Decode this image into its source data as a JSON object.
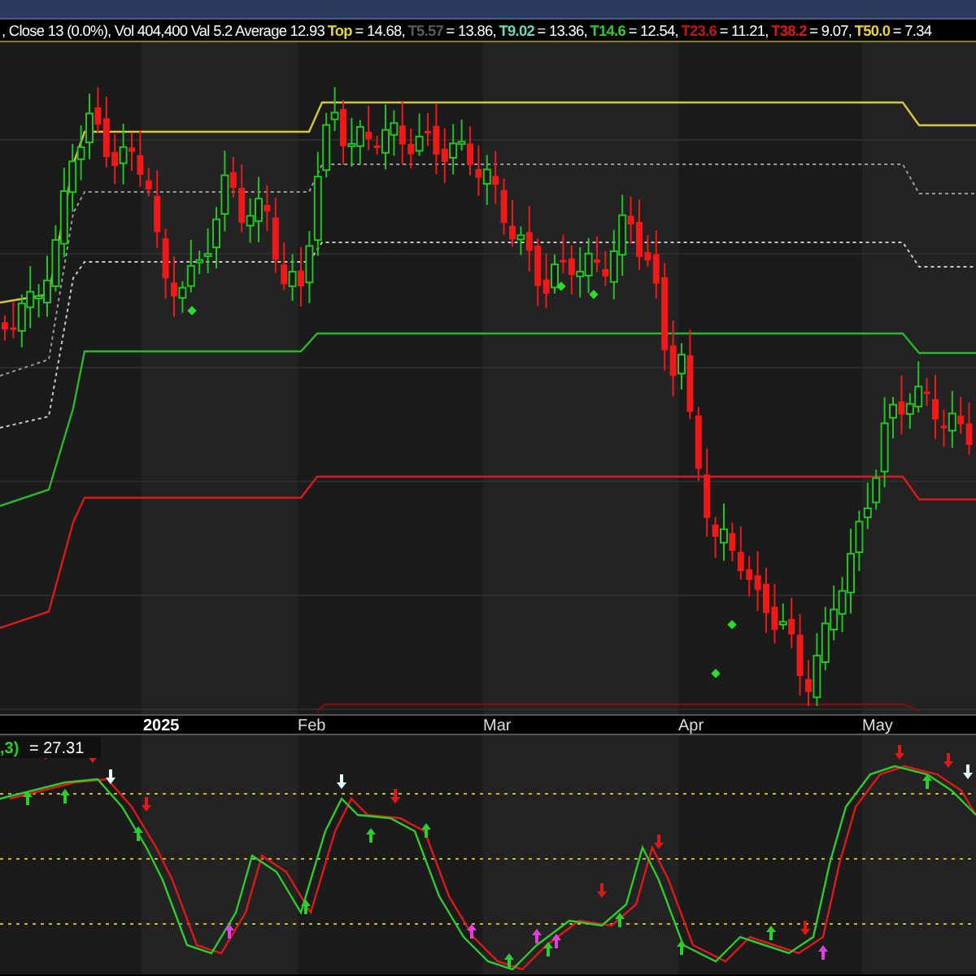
{
  "header": {
    "prefix": ", Close 13 (0.0%), Vol 404,400 Val 5.2 Average 12.93",
    "levels": [
      {
        "name": "Top",
        "color": "#e6d23a",
        "value": "= 14.68,"
      },
      {
        "name": "T5.57",
        "color": "#5a5a5a",
        "value": "= 13.86,"
      },
      {
        "name": "T9.02",
        "color": "#6fd6b8",
        "value": "= 13.36,"
      },
      {
        "name": "T14.6",
        "color": "#2ecc2e",
        "value": "= 12.54,"
      },
      {
        "name": "T23.6",
        "color": "#c81414",
        "value": "= 11.21,"
      },
      {
        "name": "T38.2",
        "color": "#d81818",
        "value": "= 9.07,"
      },
      {
        "name": "T50.0",
        "color": "#e6d23a",
        "value": "= 7.34"
      }
    ]
  },
  "x_axis": {
    "labels": [
      "2025",
      "Feb",
      "Mar",
      "Apr",
      "May"
    ]
  },
  "indicator": {
    "name": ",3)",
    "color": "#2ecc2e",
    "value": "= 27.31"
  }
}
